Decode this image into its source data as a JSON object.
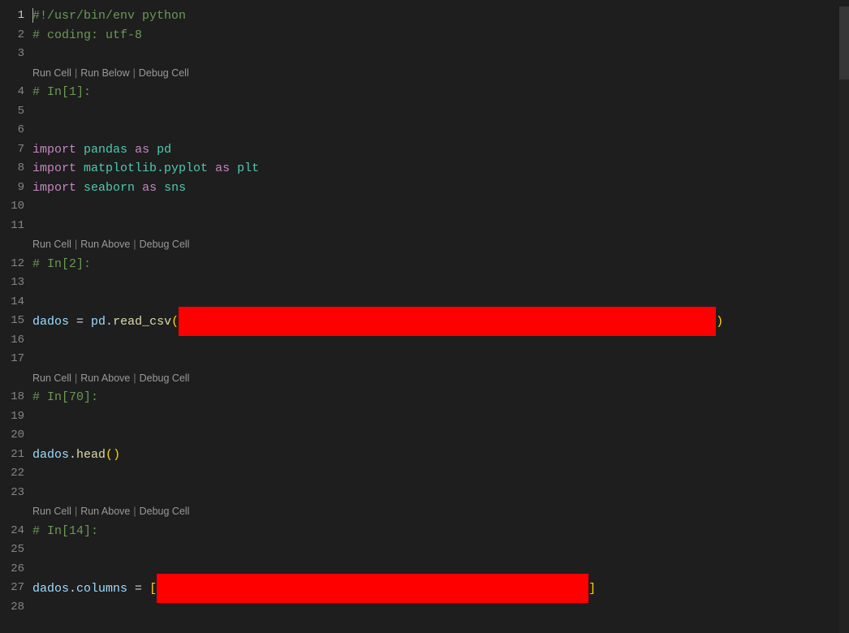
{
  "gutter": [
    "1",
    "2",
    "3",
    "4",
    "5",
    "6",
    "7",
    "8",
    "9",
    "10",
    "11",
    "12",
    "13",
    "14",
    "15",
    "16",
    "17",
    "18",
    "19",
    "20",
    "21",
    "22",
    "23",
    "24",
    "25",
    "26",
    "27",
    "28"
  ],
  "codelens": {
    "first": {
      "a": "Run Cell",
      "b": "Run Below",
      "c": "Debug Cell"
    },
    "rest": {
      "a": "Run Cell",
      "b": "Run Above",
      "c": "Debug Cell"
    },
    "sep": "|"
  },
  "code": {
    "l1a": "#!/usr/bin/env python",
    "l2": "# coding: utf-8",
    "l4": "# In[1]:",
    "l7_kw": "import",
    "l7_mod": "pandas",
    "l7_as": "as",
    "l7_alias": "pd",
    "l8_kw": "import",
    "l8_mod": "matplotlib.pyplot",
    "l8_as": "as",
    "l8_alias": "plt",
    "l9_kw": "import",
    "l9_mod": "seaborn",
    "l9_as": "as",
    "l9_alias": "sns",
    "l12": "# In[2]:",
    "l15_a": "dados",
    "l15_b": " = ",
    "l15_c": "pd",
    "l15_d": ".",
    "l15_e": "read_csv",
    "l15_f": "(",
    "l15_g": ")",
    "l18": "# In[70]:",
    "l21_a": "dados",
    "l21_b": ".",
    "l21_c": "head",
    "l21_d": "(",
    "l21_e": ")",
    "l24": "# In[14]:",
    "l27_a": "dados",
    "l27_b": ".",
    "l27_c": "columns",
    "l27_d": " = ",
    "l27_e": "[",
    "l27_f": "]"
  },
  "redact": {
    "w1": 662,
    "w2": 532
  }
}
